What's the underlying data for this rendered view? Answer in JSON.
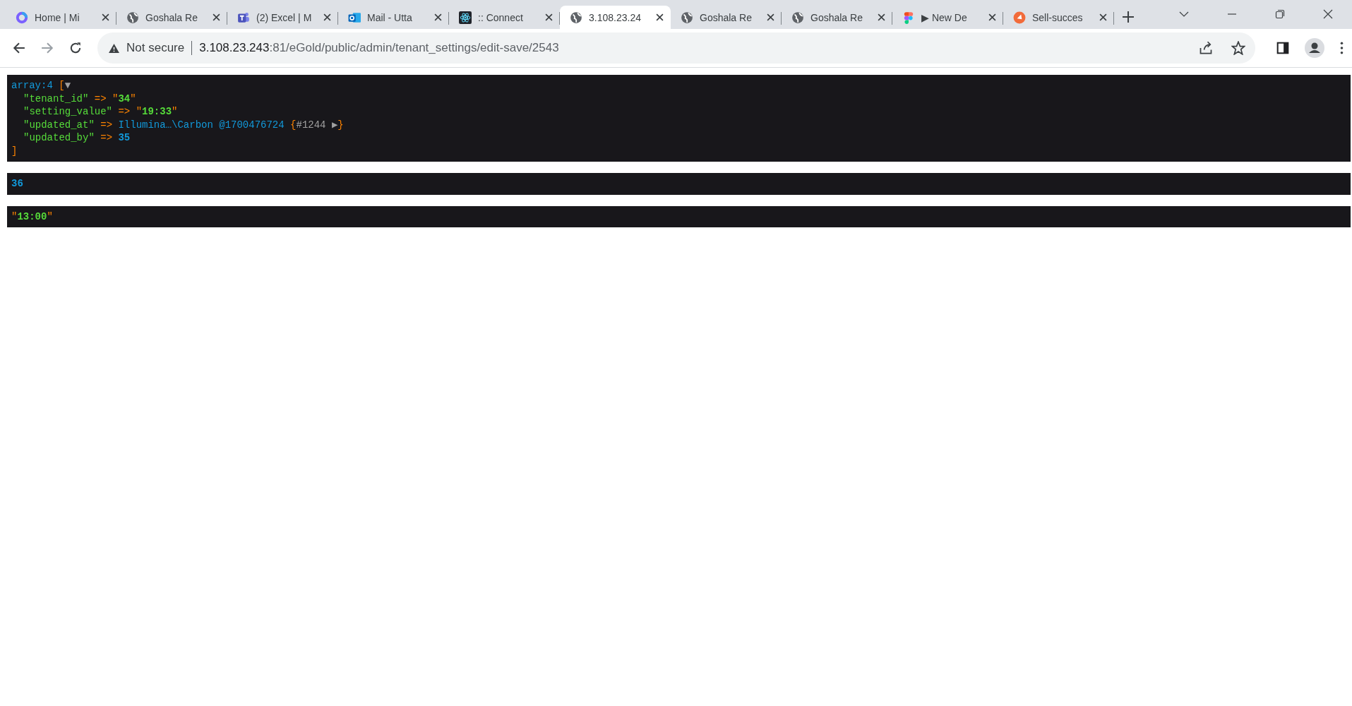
{
  "tabs": [
    {
      "title": "Home | Mi",
      "kind": "ring",
      "selected": false
    },
    {
      "title": "Goshala Re",
      "kind": "globe",
      "selected": false
    },
    {
      "title": "(2) Excel | M",
      "kind": "people",
      "selected": false
    },
    {
      "title": "Mail - Utta",
      "kind": "mail",
      "selected": false
    },
    {
      "title": ":: Connect",
      "kind": "atom",
      "selected": false
    },
    {
      "title": "3.108.23.24",
      "kind": "globe",
      "selected": true
    },
    {
      "title": "Goshala Re",
      "kind": "globe",
      "selected": false
    },
    {
      "title": "Goshala Re",
      "kind": "globe",
      "selected": false
    },
    {
      "title": "▶ New De",
      "kind": "dots",
      "selected": false
    },
    {
      "title": "Sell-succes",
      "kind": "orange",
      "selected": false
    }
  ],
  "address": {
    "security": "Not secure",
    "host": "3.108.23.243",
    "path": ":81/eGold/public/admin/tenant_settings/edit-save/2543"
  },
  "dumps": [
    {
      "open": [
        {
          "kind": "type",
          "text": "array:4 "
        },
        {
          "kind": "punct",
          "text": "["
        },
        {
          "kind": "toggle",
          "text": "▼"
        }
      ],
      "entries": [
        [
          {
            "kind": "key",
            "text": "\"tenant_id\""
          },
          {
            "kind": "op",
            "text": " => "
          },
          {
            "kind": "punct",
            "text": "\""
          },
          {
            "kind": "str",
            "text": "34"
          },
          {
            "kind": "punct",
            "text": "\""
          }
        ],
        [
          {
            "kind": "key",
            "text": "\"setting_value\""
          },
          {
            "kind": "op",
            "text": " => "
          },
          {
            "kind": "punct",
            "text": "\""
          },
          {
            "kind": "str",
            "text": "19:33"
          },
          {
            "kind": "punct",
            "text": "\""
          }
        ],
        [
          {
            "kind": "key",
            "text": "\"updated_at\""
          },
          {
            "kind": "op",
            "text": " => "
          },
          {
            "kind": "note",
            "text": "Illumina…\\Carbon @1700476724 "
          },
          {
            "kind": "punct",
            "text": "{"
          },
          {
            "kind": "ref",
            "text": "#1244 "
          },
          {
            "kind": "toggle",
            "text": "▶"
          },
          {
            "kind": "punct",
            "text": "}"
          }
        ],
        [
          {
            "kind": "key",
            "text": "\"updated_by\""
          },
          {
            "kind": "op",
            "text": " => "
          },
          {
            "kind": "num",
            "text": "35"
          }
        ]
      ],
      "close": [
        {
          "kind": "punct",
          "text": "]"
        }
      ]
    },
    {
      "open": [
        {
          "kind": "num",
          "text": "36"
        }
      ]
    },
    {
      "open": [
        {
          "kind": "punct",
          "text": "\""
        },
        {
          "kind": "str",
          "text": "13:00"
        },
        {
          "kind": "punct",
          "text": "\""
        }
      ]
    }
  ]
}
